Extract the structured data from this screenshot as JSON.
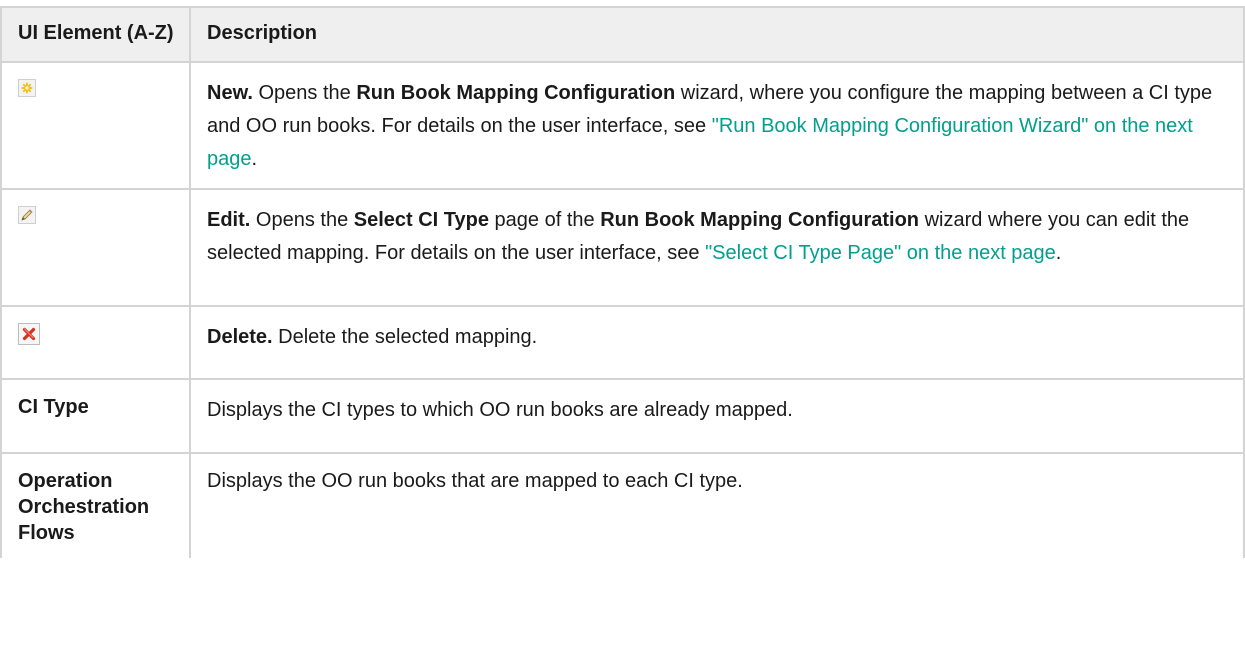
{
  "header": {
    "col1": "UI Element (A-Z)",
    "col2": "Description"
  },
  "rows": [
    {
      "icon": "new-icon",
      "label": "New.",
      "t1": " Opens the ",
      "b1": "Run Book Mapping Configuration",
      "t2": " wizard, where you configure the mapping between a CI type and OO run books. For details on the user interface, see ",
      "link": "\"Run Book Mapping Configuration Wizard\" on the next page",
      "t3": "."
    },
    {
      "icon": "edit-icon",
      "label": "Edit.",
      "t1": " Opens the ",
      "b1": "Select CI Type",
      "t2": " page of the ",
      "b2": "Run Book Mapping Configuration",
      "t3": " wizard where you can edit the selected mapping. For details on the user interface, see ",
      "link": "\"Select CI Type Page\" on the next page",
      "t4": "."
    },
    {
      "icon": "delete-icon",
      "label": "Delete.",
      "t1": " Delete the selected mapping."
    },
    {
      "name": "CI Type",
      "desc": "Displays the CI types to which OO run books are already mapped."
    },
    {
      "name": "Operation Orchestration Flows",
      "desc": "Displays the OO run books that are mapped to each CI type."
    }
  ],
  "colors": {
    "link": "#00a08c",
    "header_bg": "#efefef",
    "border": "#d4d4d4"
  }
}
